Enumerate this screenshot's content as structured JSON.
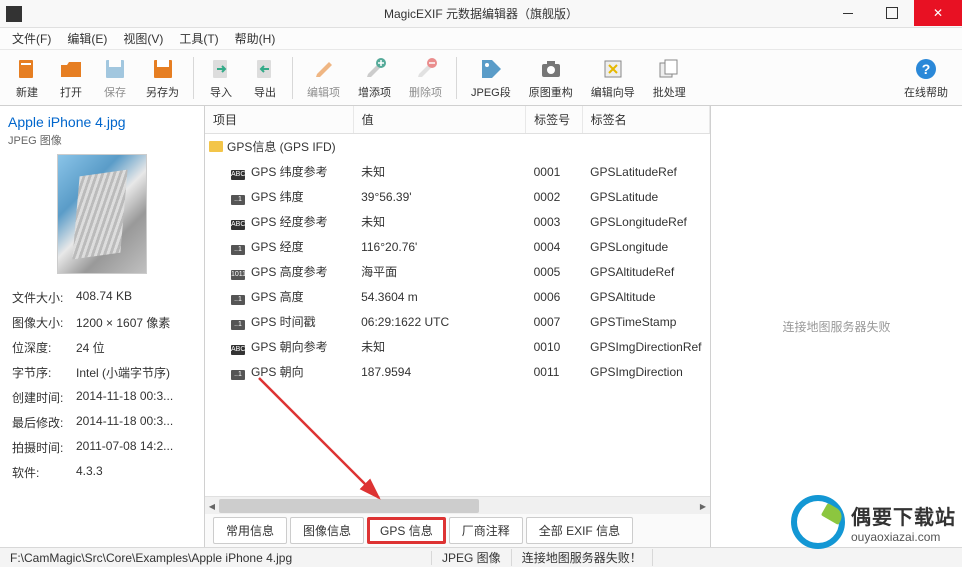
{
  "window": {
    "title": "MagicEXIF 元数据编辑器（旗舰版）"
  },
  "menu": {
    "file": "文件(F)",
    "edit": "编辑(E)",
    "view": "视图(V)",
    "tools": "工具(T)",
    "help": "帮助(H)"
  },
  "toolbar": {
    "new": "新建",
    "open": "打开",
    "save": "保存",
    "saveas": "另存为",
    "import": "导入",
    "export": "导出",
    "edit_item": "编辑项",
    "add_item": "增添项",
    "del_item": "删除项",
    "jpeg_seg": "JPEG段",
    "rebuild": "原图重构",
    "wizard": "编辑向导",
    "batch": "批处理",
    "help": "在线帮助"
  },
  "left": {
    "filename": "Apple iPhone 4.jpg",
    "filetype": "JPEG 图像",
    "meta": {
      "filesize_k": "文件大小:",
      "filesize_v": "408.74 KB",
      "imgsize_k": "图像大小:",
      "imgsize_v": "1200 × 1607 像素",
      "depth_k": "位深度:",
      "depth_v": "24 位",
      "endian_k": "字节序:",
      "endian_v": "Intel (小端字节序)",
      "ctime_k": "创建时间:",
      "ctime_v": "2014-11-18 00:3...",
      "mtime_k": "最后修改:",
      "mtime_v": "2014-11-18 00:3...",
      "dtime_k": "拍摄时间:",
      "dtime_v": "2011-07-08 14:2...",
      "sw_k": "软件:",
      "sw_v": "4.3.3"
    }
  },
  "grid": {
    "cols": {
      "item": "项目",
      "value": "值",
      "tagno": "标签号",
      "tagname": "标签名"
    },
    "group": "GPS信息 (GPS IFD)",
    "rows": [
      {
        "ic": "ABC",
        "name": "GPS 纬度参考",
        "value": "未知",
        "tagno": "0001",
        "tagname": "GPSLatitudeRef"
      },
      {
        "ic": "..1",
        "name": "GPS 纬度",
        "value": "39°56.39'",
        "tagno": "0002",
        "tagname": "GPSLatitude"
      },
      {
        "ic": "ABC",
        "name": "GPS 经度参考",
        "value": "未知",
        "tagno": "0003",
        "tagname": "GPSLongitudeRef"
      },
      {
        "ic": "..1",
        "name": "GPS 经度",
        "value": "116°20.76'",
        "tagno": "0004",
        "tagname": "GPSLongitude"
      },
      {
        "ic": "1011",
        "name": "GPS 高度参考",
        "value": "海平面",
        "tagno": "0005",
        "tagname": "GPSAltitudeRef"
      },
      {
        "ic": "..1",
        "name": "GPS 高度",
        "value": "54.3604 m",
        "tagno": "0006",
        "tagname": "GPSAltitude"
      },
      {
        "ic": "..1",
        "name": "GPS 时间戳",
        "value": "06:29:1622 UTC",
        "tagno": "0007",
        "tagname": "GPSTimeStamp"
      },
      {
        "ic": "ABC",
        "name": "GPS 朝向参考",
        "value": "未知",
        "tagno": "0010",
        "tagname": "GPSImgDirectionRef"
      },
      {
        "ic": "..1",
        "name": "GPS 朝向",
        "value": "187.9594",
        "tagno": "0011",
        "tagname": "GPSImgDirection"
      }
    ]
  },
  "tabs": {
    "common": "常用信息",
    "image": "图像信息",
    "gps": "GPS 信息",
    "maker": "厂商注释",
    "all": "全部 EXIF 信息"
  },
  "right": {
    "map_error": "连接地图服务器失败"
  },
  "status": {
    "path": "F:\\CamMagic\\Src\\Core\\Examples\\Apple iPhone 4.jpg",
    "type": "JPEG 图像",
    "msg": "连接地图服务器失败！"
  },
  "watermark": {
    "cn": "偶要下载站",
    "en": "ouyaoxiazai.com"
  }
}
